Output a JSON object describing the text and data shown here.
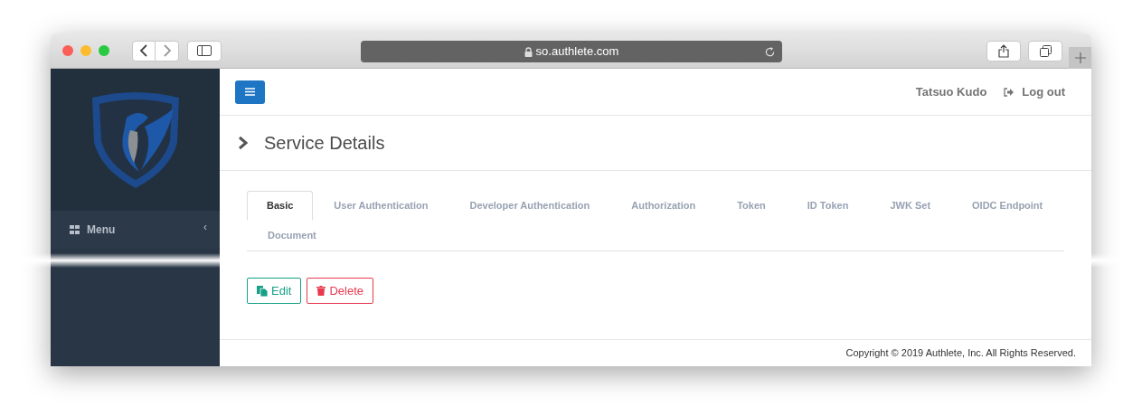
{
  "browser": {
    "url": "so.authlete.com"
  },
  "sidebar": {
    "menu_label": "Menu",
    "collapse_glyph": "‹"
  },
  "topbar": {
    "user": "Tatsuo Kudo",
    "logout": "Log out"
  },
  "page": {
    "title": "Service Details"
  },
  "tabs": [
    {
      "label": "Basic",
      "selected": true
    },
    {
      "label": "User Authentication",
      "selected": false
    },
    {
      "label": "Developer Authentication",
      "selected": false
    },
    {
      "label": "Authorization",
      "selected": false
    },
    {
      "label": "Token",
      "selected": false
    },
    {
      "label": "ID Token",
      "selected": false
    },
    {
      "label": "JWK Set",
      "selected": false
    },
    {
      "label": "OIDC Endpoint",
      "selected": false
    },
    {
      "label": "Document",
      "selected": false
    }
  ],
  "actions": [
    {
      "label": "Edit",
      "kind": "edit"
    },
    {
      "label": "Delete",
      "kind": "delete"
    }
  ],
  "footer": {
    "copyright": "Copyright © 2019 Authlete, Inc. All Rights Reserved."
  }
}
